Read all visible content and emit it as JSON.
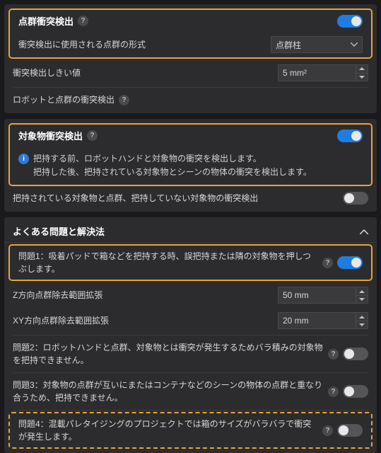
{
  "panel1": {
    "title": "点群衝突検出",
    "toggle": true,
    "form_label": "衝突検出に使用される点群の形式",
    "form_value": "点群柱",
    "threshold_label": "衝突検出しきい値",
    "threshold_value": "5 mm²",
    "robot_label": "ロボットと点群の衝突検出"
  },
  "panel2": {
    "title": "対象物衝突検出",
    "toggle": true,
    "info_line1": "把持する前、ロボットハンドと対象物の衝突を検出します。",
    "info_line2": "把持した後、把持されている対象物とシーンの物体の衝突を検出します。",
    "held_label": "把持されている対象物と点群、把持していない対象物の衝突検出",
    "held_toggle": false
  },
  "panel3": {
    "title": "よくある問題と解決法",
    "p1_text": "問題1：吸着パッドで箱などを把持する時、誤把持または隣の対象物を押しつぶします。",
    "p1_toggle": true,
    "z_label": "Z方向点群除去範囲拡張",
    "z_value": "50 mm",
    "xy_label": "XY方向点群除去範囲拡張",
    "xy_value": "20 mm",
    "p2_text": "問題2：ロボットハンドと点群、対象物とは衝突が発生するためバラ積みの対象物を把持できません。",
    "p2_toggle": false,
    "p3_text": "問題3：対象物の点群が互いにまたはコンテナなどのシーンの物体の点群と重なり合うため、把持できません。",
    "p3_toggle": false,
    "p4_text": "問題4：混載パレタイジングのプロジェクトでは箱のサイズがバラバラで衝突が発生します。",
    "p4_toggle": false
  }
}
